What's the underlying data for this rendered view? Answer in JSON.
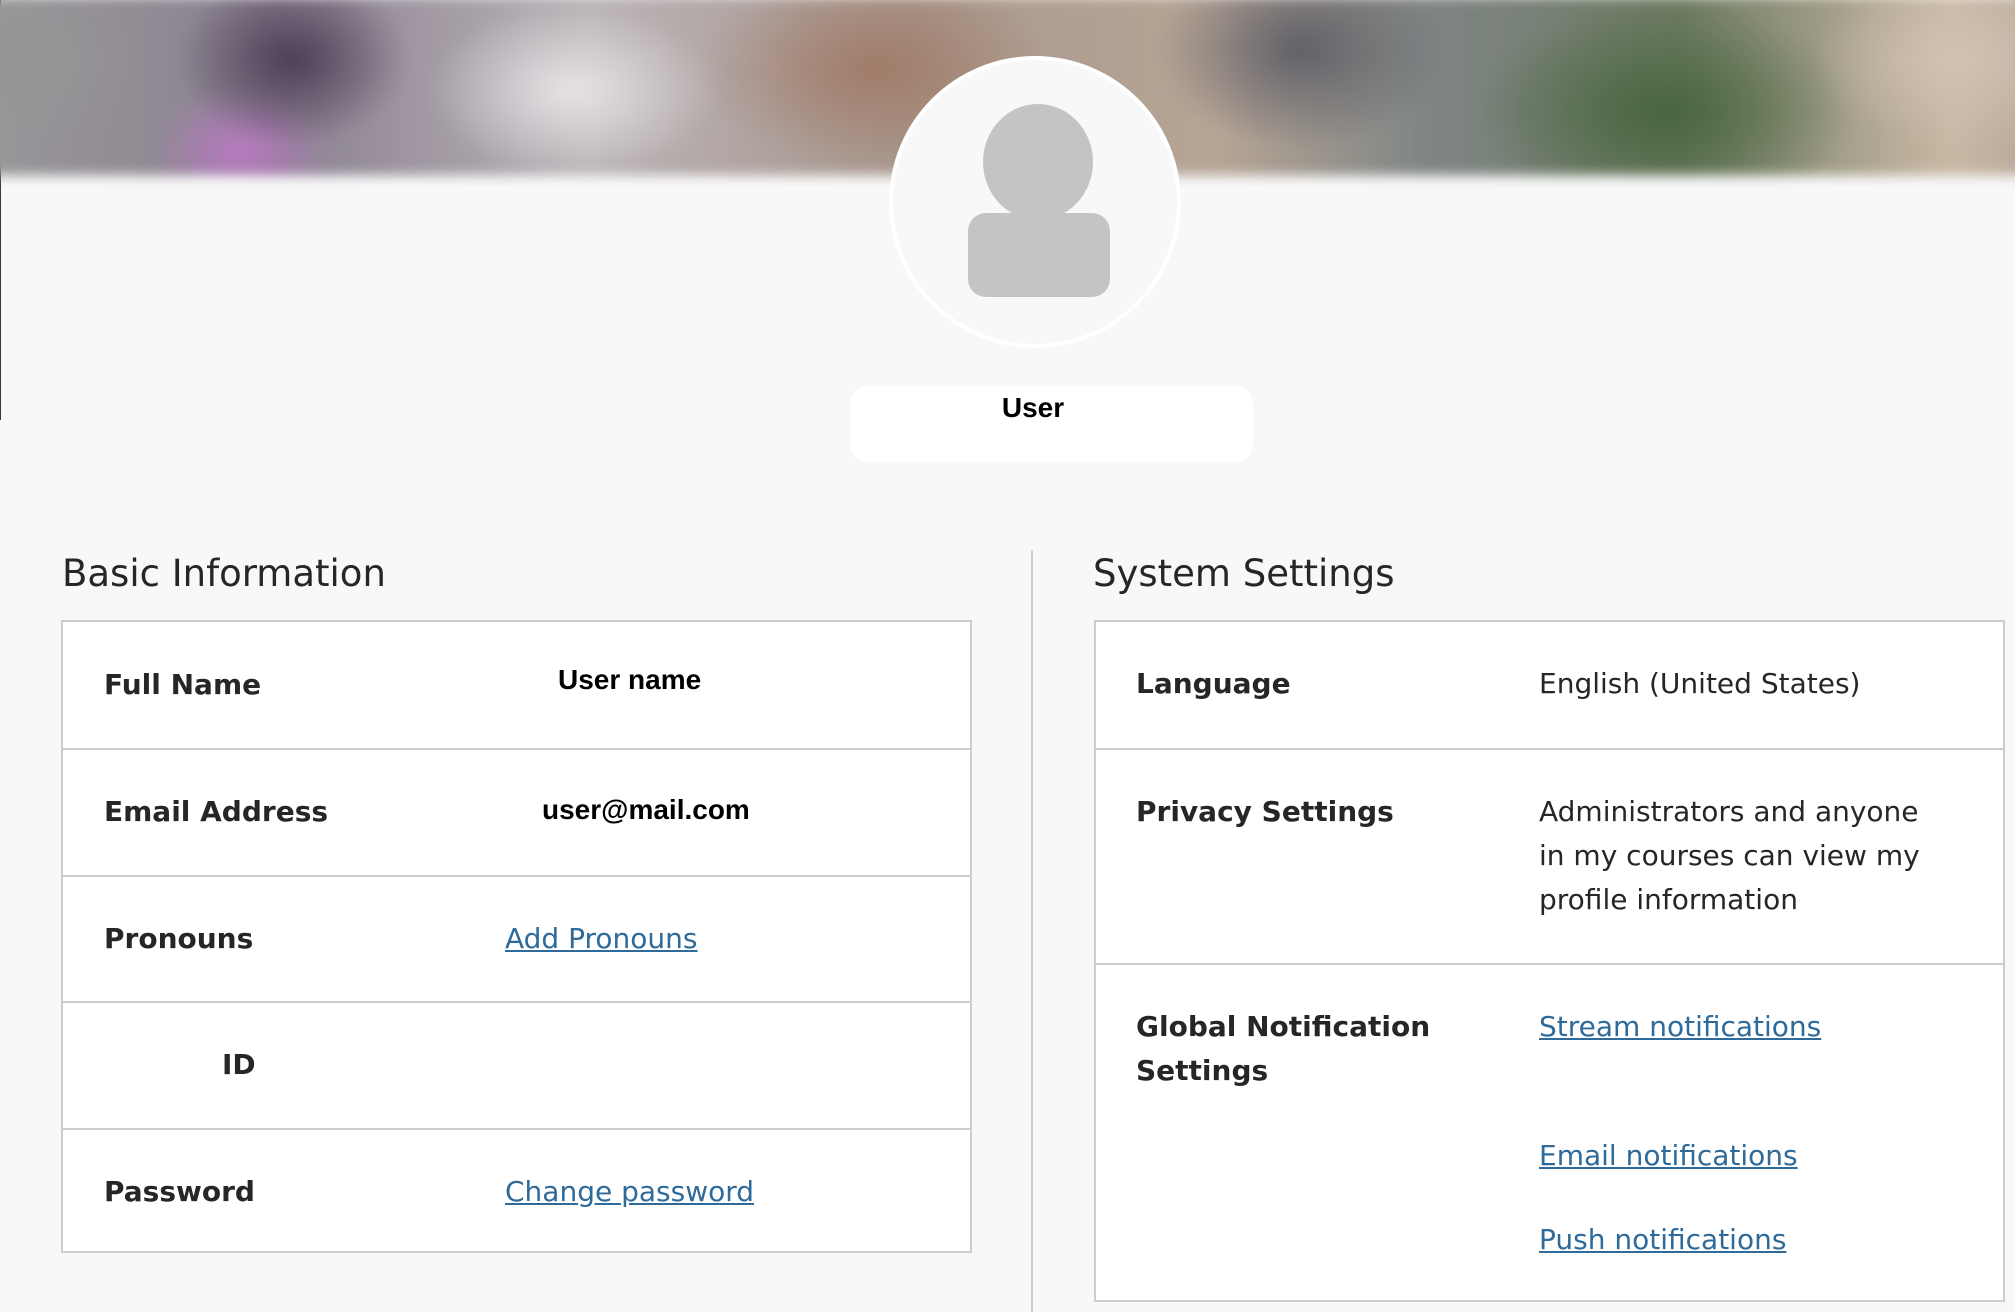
{
  "profile": {
    "display_name": "User"
  },
  "basic_information": {
    "title": "Basic Information",
    "rows": {
      "full_name": {
        "label": "Full Name",
        "value": "User name"
      },
      "email": {
        "label": "Email Address",
        "value": "user@mail.com"
      },
      "pronouns": {
        "label": "Pronouns",
        "link": "Add Pronouns"
      },
      "id": {
        "label": "ID"
      },
      "password": {
        "label": "Password",
        "link": "Change password"
      }
    }
  },
  "system_settings": {
    "title": "System Settings",
    "rows": {
      "language": {
        "label": "Language",
        "value": "English (United States)"
      },
      "privacy": {
        "label": "Privacy Settings",
        "value_lines": [
          "Administrators and anyone",
          "in my courses can view my",
          "profile information"
        ]
      },
      "notifications": {
        "label_lines": [
          "Global Notification",
          "Settings"
        ],
        "links": [
          "Stream notifications",
          "Email notifications",
          "Push notifications"
        ]
      }
    }
  },
  "colors": {
    "link": "#2e6a9a",
    "background": "#f8f8f8",
    "border": "#cdcdcd",
    "avatar_placeholder": "#c4c4c4"
  }
}
